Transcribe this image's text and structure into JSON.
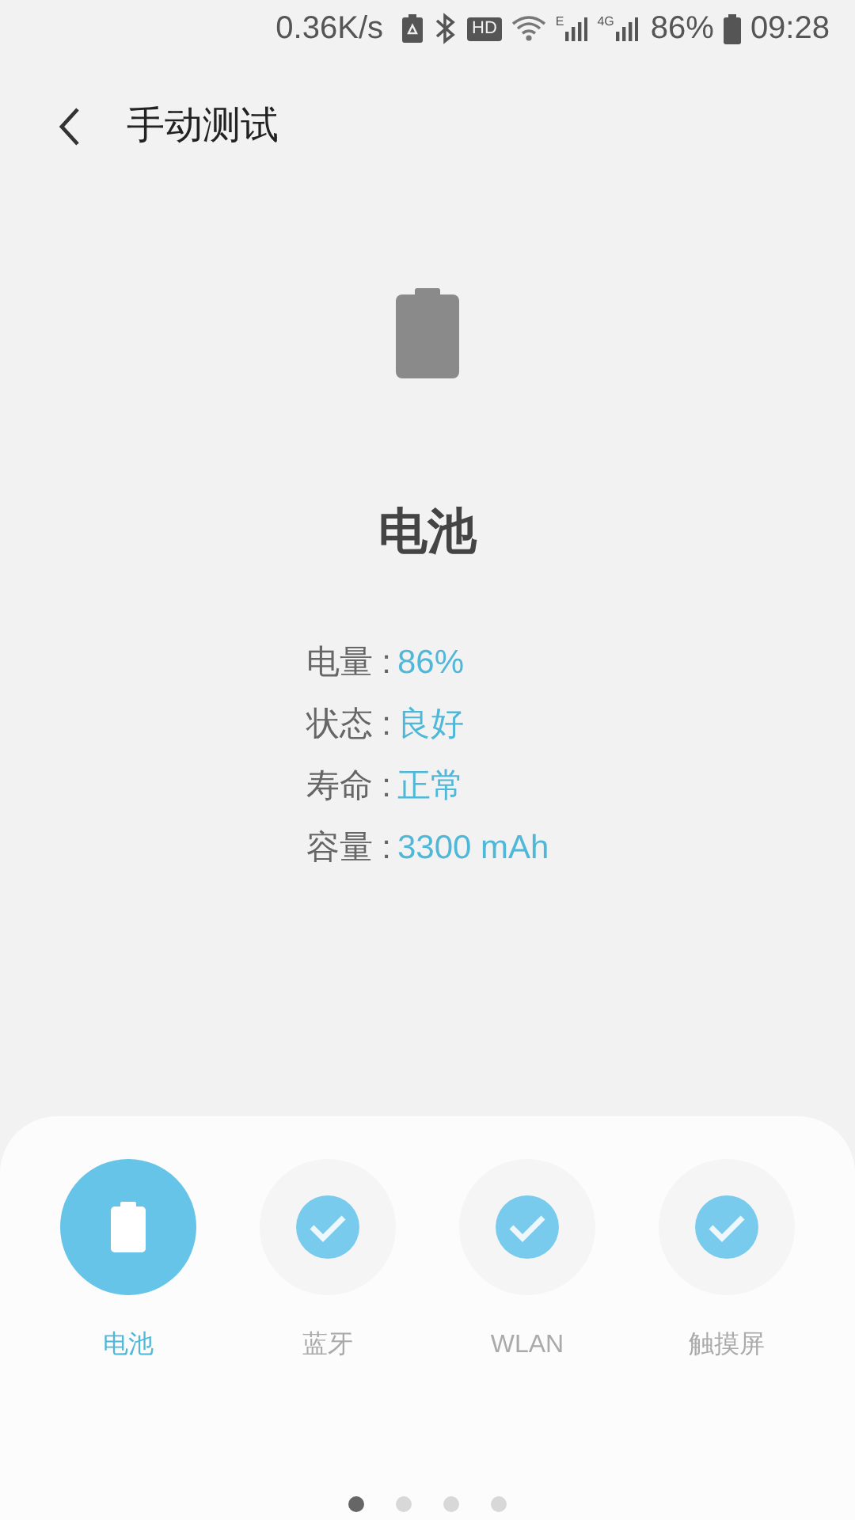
{
  "status_bar": {
    "speed": "0.36K/s",
    "hd": "HD",
    "network_1": "E",
    "network_2": "4G",
    "battery": "86%",
    "time": "09:28"
  },
  "header": {
    "title": "手动测试"
  },
  "device": {
    "name": "电池"
  },
  "info": [
    {
      "label": "电量 :",
      "value": "86%"
    },
    {
      "label": "状态 :",
      "value": "良好"
    },
    {
      "label": "寿命 :",
      "value": "正常"
    },
    {
      "label": "容量 :",
      "value": "3300 mAh"
    }
  ],
  "tests": [
    {
      "label": "电池",
      "selected": true,
      "passed": false
    },
    {
      "label": "蓝牙",
      "selected": false,
      "passed": true
    },
    {
      "label": "WLAN",
      "selected": false,
      "passed": true
    },
    {
      "label": "触摸屏",
      "selected": false,
      "passed": true
    }
  ],
  "pages": [
    {
      "selected": true
    },
    {
      "selected": false
    },
    {
      "selected": false
    },
    {
      "selected": false
    }
  ]
}
